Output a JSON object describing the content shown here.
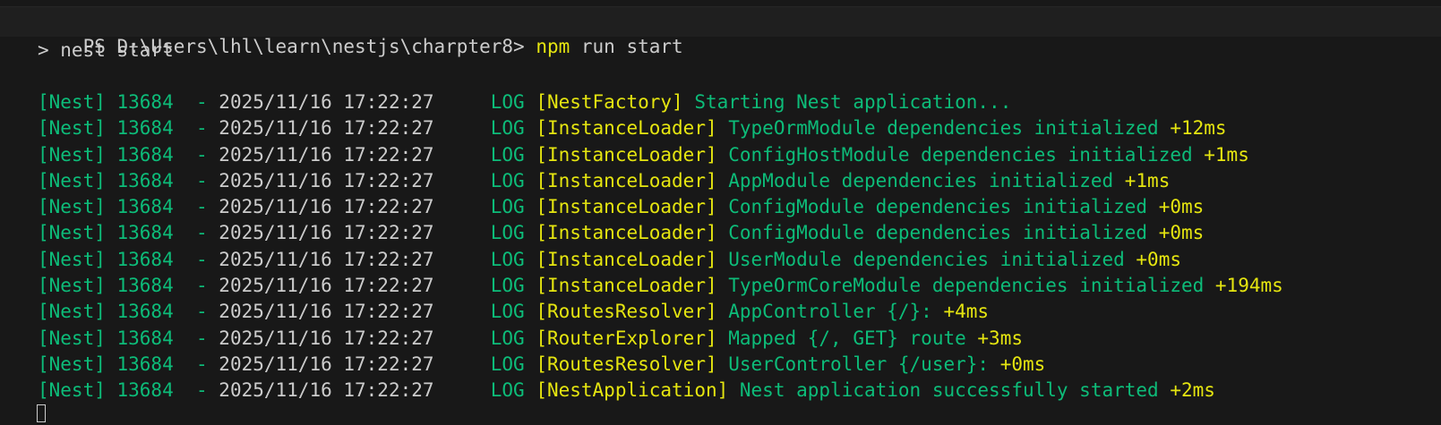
{
  "terminal": {
    "prompt": "PS D:\\Users\\lhl\\learn\\nestjs\\charpter8> ",
    "command_name": "npm",
    "command_args": " run start",
    "echo": "> nest start"
  },
  "logs": [
    {
      "prefix": "[Nest] 13684  - ",
      "timestamp": "2025/11/16 17:22:27",
      "level": "     LOG ",
      "context": "[NestFactory]",
      "message": " Starting Nest application...",
      "delta": ""
    },
    {
      "prefix": "[Nest] 13684  - ",
      "timestamp": "2025/11/16 17:22:27",
      "level": "     LOG ",
      "context": "[InstanceLoader]",
      "message": " TypeOrmModule dependencies initialized ",
      "delta": "+12ms"
    },
    {
      "prefix": "[Nest] 13684  - ",
      "timestamp": "2025/11/16 17:22:27",
      "level": "     LOG ",
      "context": "[InstanceLoader]",
      "message": " ConfigHostModule dependencies initialized ",
      "delta": "+1ms"
    },
    {
      "prefix": "[Nest] 13684  - ",
      "timestamp": "2025/11/16 17:22:27",
      "level": "     LOG ",
      "context": "[InstanceLoader]",
      "message": " AppModule dependencies initialized ",
      "delta": "+1ms"
    },
    {
      "prefix": "[Nest] 13684  - ",
      "timestamp": "2025/11/16 17:22:27",
      "level": "     LOG ",
      "context": "[InstanceLoader]",
      "message": " ConfigModule dependencies initialized ",
      "delta": "+0ms"
    },
    {
      "prefix": "[Nest] 13684  - ",
      "timestamp": "2025/11/16 17:22:27",
      "level": "     LOG ",
      "context": "[InstanceLoader]",
      "message": " ConfigModule dependencies initialized ",
      "delta": "+0ms"
    },
    {
      "prefix": "[Nest] 13684  - ",
      "timestamp": "2025/11/16 17:22:27",
      "level": "     LOG ",
      "context": "[InstanceLoader]",
      "message": " UserModule dependencies initialized ",
      "delta": "+0ms"
    },
    {
      "prefix": "[Nest] 13684  - ",
      "timestamp": "2025/11/16 17:22:27",
      "level": "     LOG ",
      "context": "[InstanceLoader]",
      "message": " TypeOrmCoreModule dependencies initialized ",
      "delta": "+194ms"
    },
    {
      "prefix": "[Nest] 13684  - ",
      "timestamp": "2025/11/16 17:22:27",
      "level": "     LOG ",
      "context": "[RoutesResolver]",
      "message": " AppController {/}: ",
      "delta": "+4ms"
    },
    {
      "prefix": "[Nest] 13684  - ",
      "timestamp": "2025/11/16 17:22:27",
      "level": "     LOG ",
      "context": "[RouterExplorer]",
      "message": " Mapped {/, GET} route ",
      "delta": "+3ms"
    },
    {
      "prefix": "[Nest] 13684  - ",
      "timestamp": "2025/11/16 17:22:27",
      "level": "     LOG ",
      "context": "[RoutesResolver]",
      "message": " UserController {/user}: ",
      "delta": "+0ms"
    },
    {
      "prefix": "[Nest] 13684  - ",
      "timestamp": "2025/11/16 17:22:27",
      "level": "     LOG ",
      "context": "[NestApplication]",
      "message": " Nest application successfully started ",
      "delta": "+2ms"
    }
  ],
  "colors": {
    "background": "#181818",
    "prompt_bar": "#1f1f1f",
    "default_text": "#cccccc",
    "command": "#e5e510",
    "log_green": "#0dbc79",
    "log_yellow": "#e5e510"
  }
}
